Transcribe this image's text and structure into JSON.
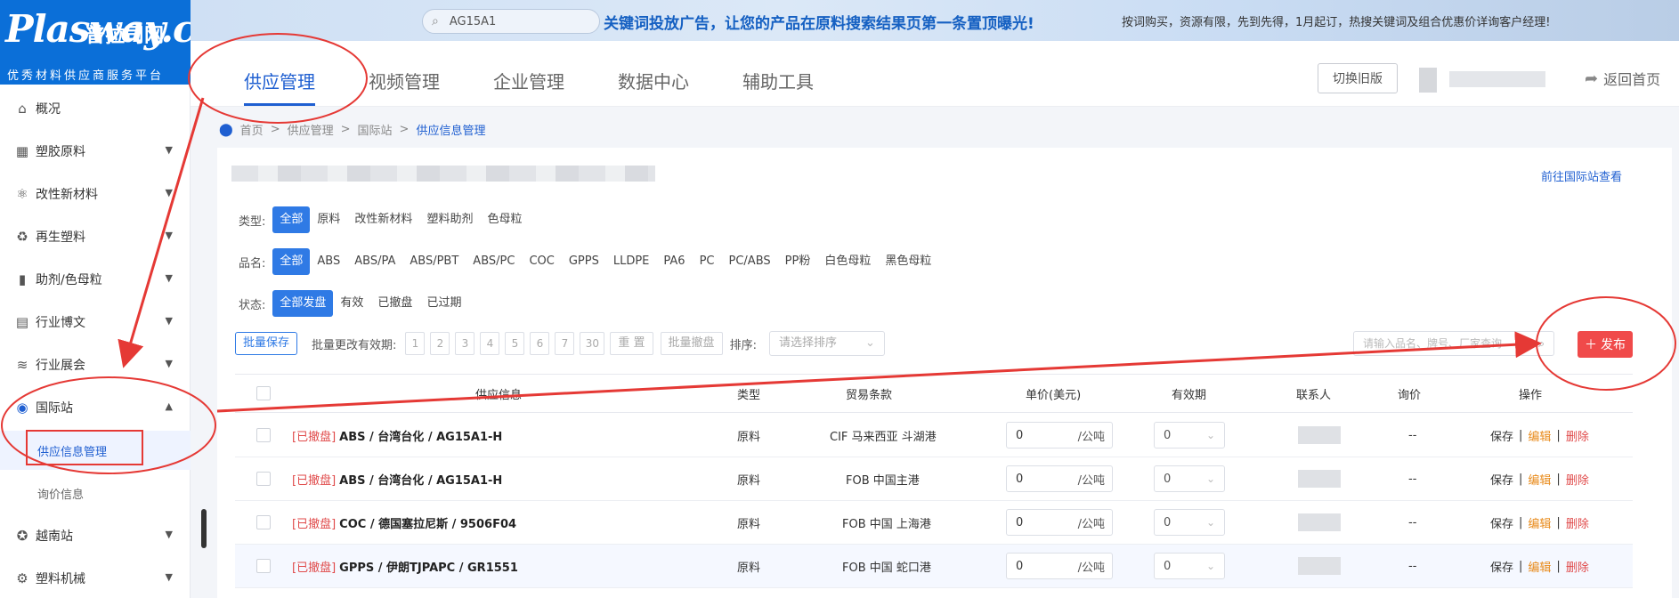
{
  "sidebar": {
    "brand": "Plasway.com",
    "brand_cn": "普拉司网",
    "slogan": "优秀材料供应商服务平台",
    "items": [
      {
        "label": "概况",
        "icon": "home-icon"
      },
      {
        "label": "塑胶原料",
        "icon": "factory-icon"
      },
      {
        "label": "改性新材料",
        "icon": "molecule-icon"
      },
      {
        "label": "再生塑料",
        "icon": "recycle-icon"
      },
      {
        "label": "助剂/色母粒",
        "icon": "bottle-icon"
      },
      {
        "label": "行业博文",
        "icon": "article-icon"
      },
      {
        "label": "行业展会",
        "icon": "expo-icon"
      },
      {
        "label": "国际站",
        "icon": "globe-icon"
      },
      {
        "label": "越南站",
        "icon": "flag-icon"
      },
      {
        "label": "塑料机械",
        "icon": "gear-icon"
      }
    ],
    "sub_items": [
      {
        "label": "供应信息管理"
      },
      {
        "label": "询价信息"
      }
    ]
  },
  "banner": {
    "search_value": "AG15A1",
    "headline": "关键词投放广告，让您的产品在原料搜索结果页第一条置顶曝光!",
    "subline": "按词购买，资源有限，先到先得，1月起订，热搜关键词及组合优惠价详询客户经理!"
  },
  "header": {
    "nav": [
      "供应管理",
      "视频管理",
      "企业管理",
      "数据中心",
      "辅助工具"
    ],
    "switch_label": "切换旧版",
    "back_home": "返回首页"
  },
  "breadcrumb": [
    "首页",
    "供应管理",
    "国际站",
    "供应信息管理"
  ],
  "main": {
    "goto_intl": "前往国际站查看",
    "filters": {
      "type_label": "类型:",
      "type_options": [
        "全部",
        "原料",
        "改性新材料",
        "塑料助剂",
        "色母粒"
      ],
      "name_label": "品名:",
      "name_options": [
        "全部",
        "ABS",
        "ABS/PA",
        "ABS/PBT",
        "ABS/PC",
        "COC",
        "GPPS",
        "LLDPE",
        "PA6",
        "PC",
        "PC/ABS",
        "PP粉",
        "白色母粒",
        "黑色母粒"
      ],
      "status_label": "状态:",
      "status_options": [
        "全部发盘",
        "有效",
        "已撤盘",
        "已过期"
      ]
    },
    "toolbar": {
      "batch_save": "批量保存",
      "batch_validity_label": "批量更改有效期:",
      "day_options": [
        "1",
        "2",
        "3",
        "4",
        "5",
        "6",
        "7",
        "30"
      ],
      "reset": "重 置",
      "batch_withdraw": "批量撤盘",
      "sort_label": "排序:",
      "sort_placeholder": "请选择排序",
      "search_placeholder": "请输入品名、牌号、厂家查询",
      "publish": "发布"
    },
    "table": {
      "columns": [
        "供应信息",
        "类型",
        "贸易条款",
        "单价(美元)",
        "有效期",
        "联系人",
        "询价",
        "操作"
      ],
      "rows": [
        {
          "status": "[已撤盘]",
          "product": "ABS / 台湾台化 / AG15A1-H",
          "type": "原料",
          "terms": "CIF 马来西亚 斗湖港",
          "price": "0",
          "unit": "/公吨",
          "validity": "0",
          "inquiry": "--"
        },
        {
          "status": "[已撤盘]",
          "product": "ABS / 台湾台化 / AG15A1-H",
          "type": "原料",
          "terms": "FOB 中国主港",
          "price": "0",
          "unit": "/公吨",
          "validity": "0",
          "inquiry": "--"
        },
        {
          "status": "[已撤盘]",
          "product": "COC / 德国塞拉尼斯 / 9506F04",
          "type": "原料",
          "terms": "FOB 中国 上海港",
          "price": "0",
          "unit": "/公吨",
          "validity": "0",
          "inquiry": "--"
        },
        {
          "status": "[已撤盘]",
          "product": "GPPS / 伊朗TJPAPC / GR1551",
          "type": "原料",
          "terms": "FOB 中国 蛇口港",
          "price": "0",
          "unit": "/公吨",
          "validity": "0",
          "inquiry": "--"
        }
      ],
      "actions": {
        "save": "保存",
        "edit": "编辑",
        "delete": "删除"
      }
    }
  },
  "colors": {
    "primary": "#2f7ae5",
    "danger": "#f04a4a",
    "annotation": "#e53935",
    "edit": "#e88a1a"
  }
}
